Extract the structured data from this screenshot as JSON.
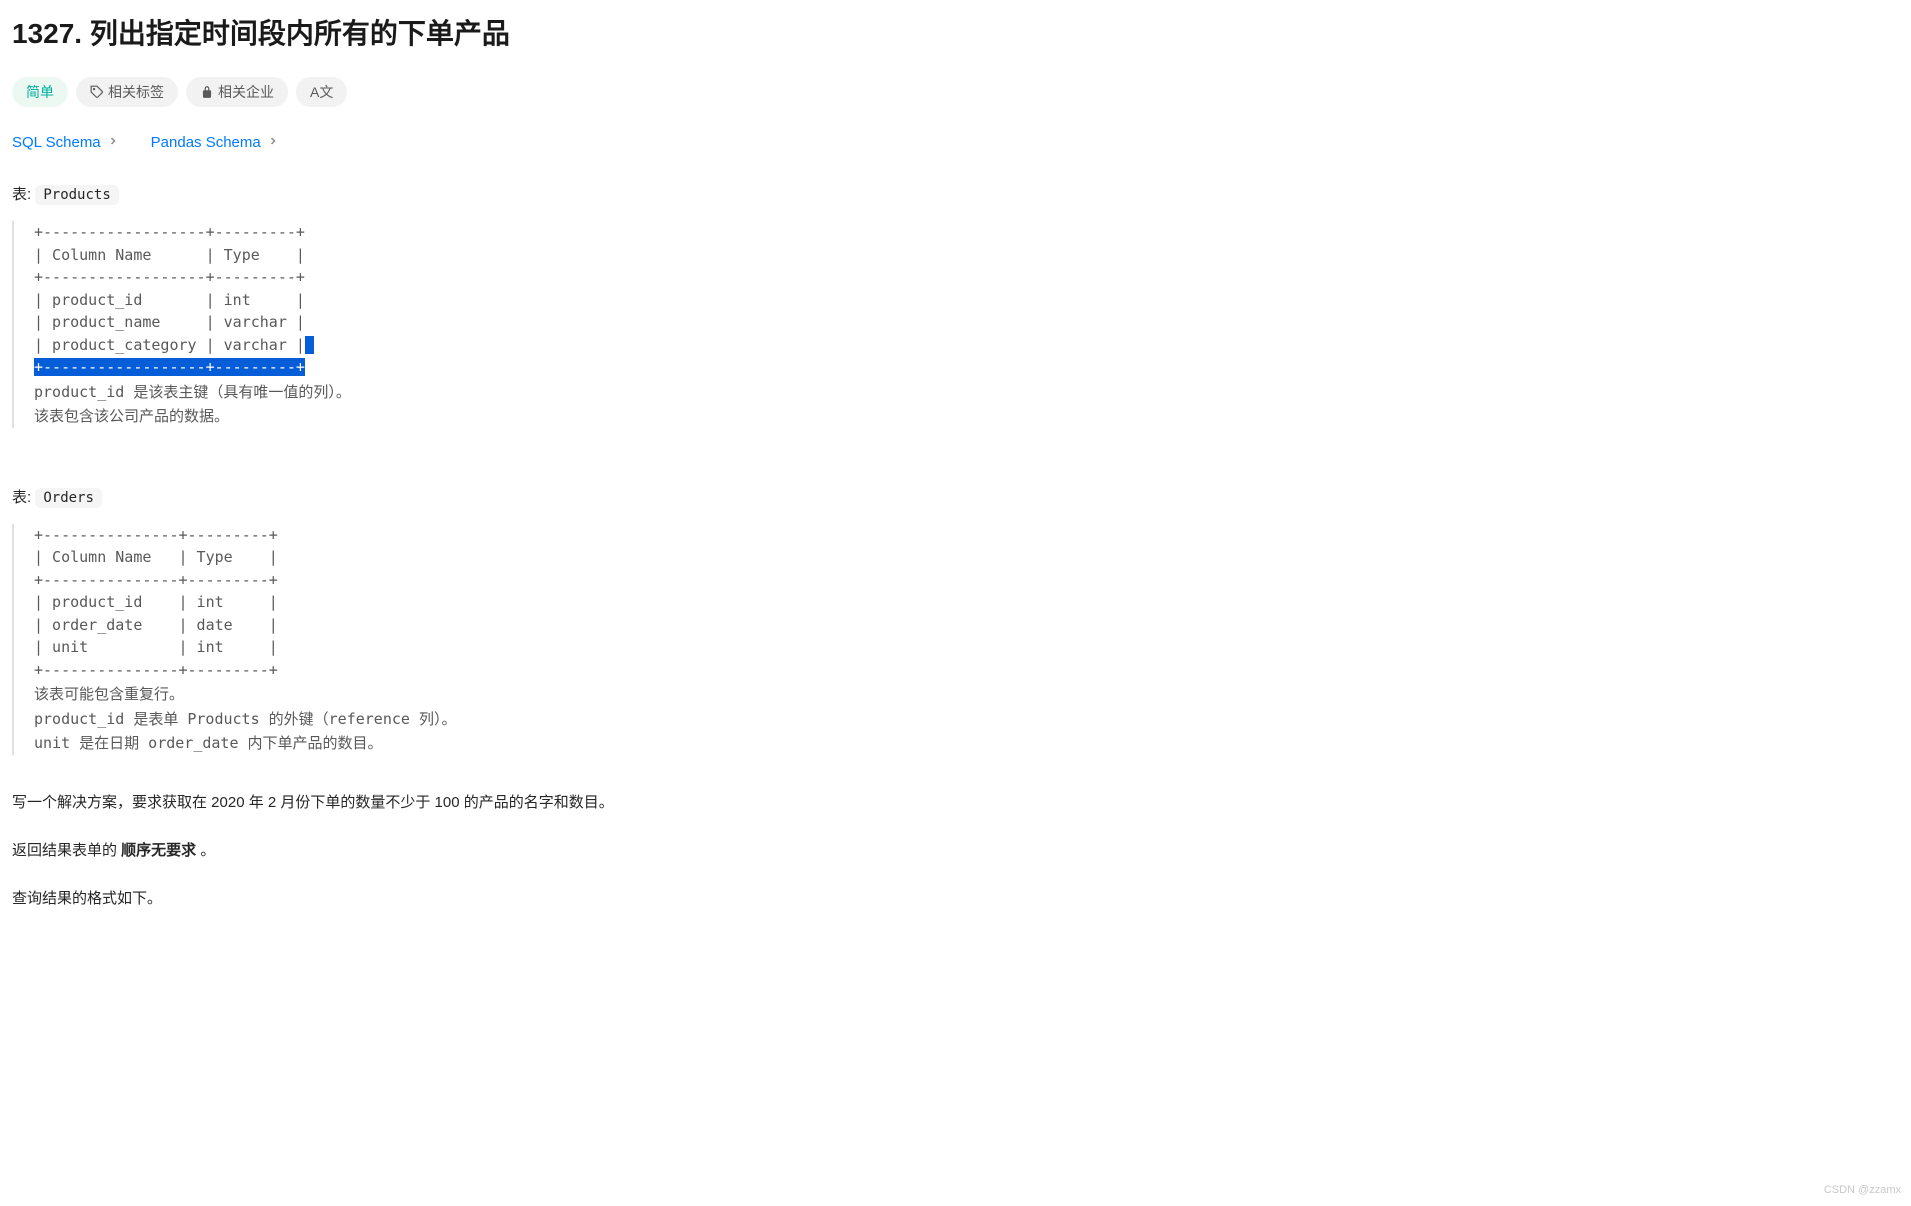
{
  "title": {
    "number": "1327.",
    "text": "列出指定时间段内所有的下单产品"
  },
  "chips": {
    "difficulty": "简单",
    "tags": "相关标签",
    "companies": "相关企业",
    "lang": "A文"
  },
  "schema_links": {
    "sql": "SQL Schema",
    "pandas": "Pandas Schema"
  },
  "products_section": {
    "prefix": "表:",
    "name": "Products",
    "table": "+------------------+---------+\n| Column Name      | Type    |\n+------------------+---------+\n| product_id       | int     |\n| product_name     | varchar |\n| product_category | varchar |",
    "row_end_space": " ",
    "divider_highlight": "+------------------+---------+",
    "desc1": "product_id 是该表主键（具有唯一值的列）。",
    "desc2": "该表包含该公司产品的数据。"
  },
  "orders_section": {
    "prefix": "表:",
    "name": "Orders",
    "table": "+---------------+---------+\n| Column Name   | Type    |\n+---------------+---------+\n| product_id    | int     |\n| order_date    | date    |\n| unit          | int     |\n+---------------+---------+",
    "desc1": "该表可能包含重复行。",
    "desc2": "product_id 是表单 Products 的外键（reference 列）。",
    "desc3": "unit 是在日期 order_date 内下单产品的数目。"
  },
  "prompt": "写一个解决方案，要求获取在 2020 年 2 月份下单的数量不少于 100 的产品的名字和数目。",
  "result_order": {
    "prefix": "返回结果表单的 ",
    "bold": "顺序无要求",
    "suffix": " 。"
  },
  "format_line": "查询结果的格式如下。",
  "watermark": "CSDN @zzamx"
}
